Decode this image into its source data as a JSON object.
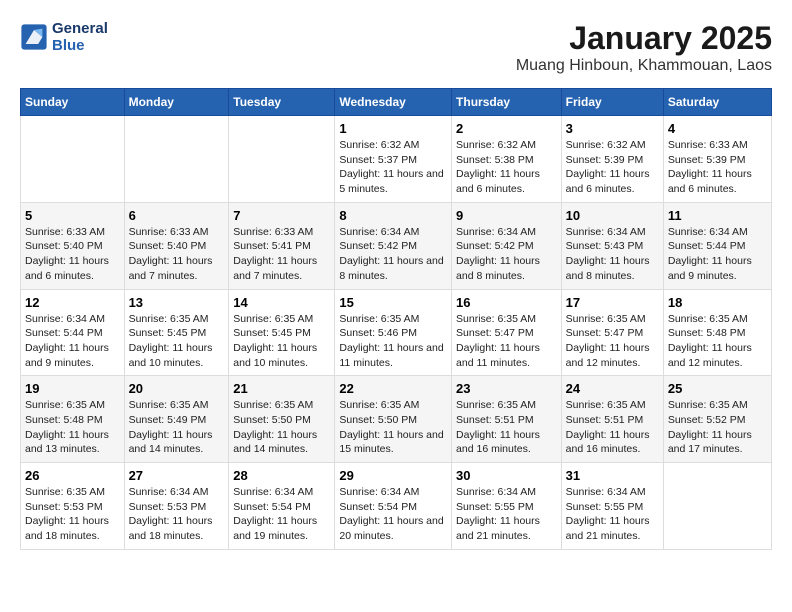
{
  "header": {
    "logo_line1": "General",
    "logo_line2": "Blue",
    "month_title": "January 2025",
    "location": "Muang Hinboun, Khammouan, Laos"
  },
  "weekdays": [
    "Sunday",
    "Monday",
    "Tuesday",
    "Wednesday",
    "Thursday",
    "Friday",
    "Saturday"
  ],
  "weeks": [
    [
      {
        "day": "",
        "sunrise": "",
        "sunset": "",
        "daylight": ""
      },
      {
        "day": "",
        "sunrise": "",
        "sunset": "",
        "daylight": ""
      },
      {
        "day": "",
        "sunrise": "",
        "sunset": "",
        "daylight": ""
      },
      {
        "day": "1",
        "sunrise": "Sunrise: 6:32 AM",
        "sunset": "Sunset: 5:37 PM",
        "daylight": "Daylight: 11 hours and 5 minutes."
      },
      {
        "day": "2",
        "sunrise": "Sunrise: 6:32 AM",
        "sunset": "Sunset: 5:38 PM",
        "daylight": "Daylight: 11 hours and 6 minutes."
      },
      {
        "day": "3",
        "sunrise": "Sunrise: 6:32 AM",
        "sunset": "Sunset: 5:39 PM",
        "daylight": "Daylight: 11 hours and 6 minutes."
      },
      {
        "day": "4",
        "sunrise": "Sunrise: 6:33 AM",
        "sunset": "Sunset: 5:39 PM",
        "daylight": "Daylight: 11 hours and 6 minutes."
      }
    ],
    [
      {
        "day": "5",
        "sunrise": "Sunrise: 6:33 AM",
        "sunset": "Sunset: 5:40 PM",
        "daylight": "Daylight: 11 hours and 6 minutes."
      },
      {
        "day": "6",
        "sunrise": "Sunrise: 6:33 AM",
        "sunset": "Sunset: 5:40 PM",
        "daylight": "Daylight: 11 hours and 7 minutes."
      },
      {
        "day": "7",
        "sunrise": "Sunrise: 6:33 AM",
        "sunset": "Sunset: 5:41 PM",
        "daylight": "Daylight: 11 hours and 7 minutes."
      },
      {
        "day": "8",
        "sunrise": "Sunrise: 6:34 AM",
        "sunset": "Sunset: 5:42 PM",
        "daylight": "Daylight: 11 hours and 8 minutes."
      },
      {
        "day": "9",
        "sunrise": "Sunrise: 6:34 AM",
        "sunset": "Sunset: 5:42 PM",
        "daylight": "Daylight: 11 hours and 8 minutes."
      },
      {
        "day": "10",
        "sunrise": "Sunrise: 6:34 AM",
        "sunset": "Sunset: 5:43 PM",
        "daylight": "Daylight: 11 hours and 8 minutes."
      },
      {
        "day": "11",
        "sunrise": "Sunrise: 6:34 AM",
        "sunset": "Sunset: 5:44 PM",
        "daylight": "Daylight: 11 hours and 9 minutes."
      }
    ],
    [
      {
        "day": "12",
        "sunrise": "Sunrise: 6:34 AM",
        "sunset": "Sunset: 5:44 PM",
        "daylight": "Daylight: 11 hours and 9 minutes."
      },
      {
        "day": "13",
        "sunrise": "Sunrise: 6:35 AM",
        "sunset": "Sunset: 5:45 PM",
        "daylight": "Daylight: 11 hours and 10 minutes."
      },
      {
        "day": "14",
        "sunrise": "Sunrise: 6:35 AM",
        "sunset": "Sunset: 5:45 PM",
        "daylight": "Daylight: 11 hours and 10 minutes."
      },
      {
        "day": "15",
        "sunrise": "Sunrise: 6:35 AM",
        "sunset": "Sunset: 5:46 PM",
        "daylight": "Daylight: 11 hours and 11 minutes."
      },
      {
        "day": "16",
        "sunrise": "Sunrise: 6:35 AM",
        "sunset": "Sunset: 5:47 PM",
        "daylight": "Daylight: 11 hours and 11 minutes."
      },
      {
        "day": "17",
        "sunrise": "Sunrise: 6:35 AM",
        "sunset": "Sunset: 5:47 PM",
        "daylight": "Daylight: 11 hours and 12 minutes."
      },
      {
        "day": "18",
        "sunrise": "Sunrise: 6:35 AM",
        "sunset": "Sunset: 5:48 PM",
        "daylight": "Daylight: 11 hours and 12 minutes."
      }
    ],
    [
      {
        "day": "19",
        "sunrise": "Sunrise: 6:35 AM",
        "sunset": "Sunset: 5:48 PM",
        "daylight": "Daylight: 11 hours and 13 minutes."
      },
      {
        "day": "20",
        "sunrise": "Sunrise: 6:35 AM",
        "sunset": "Sunset: 5:49 PM",
        "daylight": "Daylight: 11 hours and 14 minutes."
      },
      {
        "day": "21",
        "sunrise": "Sunrise: 6:35 AM",
        "sunset": "Sunset: 5:50 PM",
        "daylight": "Daylight: 11 hours and 14 minutes."
      },
      {
        "day": "22",
        "sunrise": "Sunrise: 6:35 AM",
        "sunset": "Sunset: 5:50 PM",
        "daylight": "Daylight: 11 hours and 15 minutes."
      },
      {
        "day": "23",
        "sunrise": "Sunrise: 6:35 AM",
        "sunset": "Sunset: 5:51 PM",
        "daylight": "Daylight: 11 hours and 16 minutes."
      },
      {
        "day": "24",
        "sunrise": "Sunrise: 6:35 AM",
        "sunset": "Sunset: 5:51 PM",
        "daylight": "Daylight: 11 hours and 16 minutes."
      },
      {
        "day": "25",
        "sunrise": "Sunrise: 6:35 AM",
        "sunset": "Sunset: 5:52 PM",
        "daylight": "Daylight: 11 hours and 17 minutes."
      }
    ],
    [
      {
        "day": "26",
        "sunrise": "Sunrise: 6:35 AM",
        "sunset": "Sunset: 5:53 PM",
        "daylight": "Daylight: 11 hours and 18 minutes."
      },
      {
        "day": "27",
        "sunrise": "Sunrise: 6:34 AM",
        "sunset": "Sunset: 5:53 PM",
        "daylight": "Daylight: 11 hours and 18 minutes."
      },
      {
        "day": "28",
        "sunrise": "Sunrise: 6:34 AM",
        "sunset": "Sunset: 5:54 PM",
        "daylight": "Daylight: 11 hours and 19 minutes."
      },
      {
        "day": "29",
        "sunrise": "Sunrise: 6:34 AM",
        "sunset": "Sunset: 5:54 PM",
        "daylight": "Daylight: 11 hours and 20 minutes."
      },
      {
        "day": "30",
        "sunrise": "Sunrise: 6:34 AM",
        "sunset": "Sunset: 5:55 PM",
        "daylight": "Daylight: 11 hours and 21 minutes."
      },
      {
        "day": "31",
        "sunrise": "Sunrise: 6:34 AM",
        "sunset": "Sunset: 5:55 PM",
        "daylight": "Daylight: 11 hours and 21 minutes."
      },
      {
        "day": "",
        "sunrise": "",
        "sunset": "",
        "daylight": ""
      }
    ]
  ]
}
